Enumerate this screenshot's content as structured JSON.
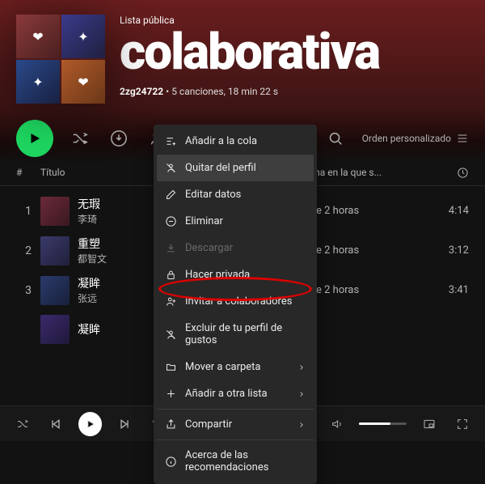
{
  "header": {
    "type_label": "Lista pública",
    "title": "colaborativa",
    "owner": "2zg24722",
    "meta_suffix": "5 canciones, 18 min 22 s"
  },
  "controls": {
    "sort_label": "Orden personalizado"
  },
  "columns": {
    "index": "#",
    "title": "Título",
    "date": "Fecha en la que s...",
    "duration_icon": "clock"
  },
  "tracks": [
    {
      "num": "1",
      "name": "无瑕",
      "artist": "李琦",
      "date": "hace 2 horas",
      "dur": "4:14",
      "c": "c1"
    },
    {
      "num": "2",
      "name": "重塑",
      "artist": "都智文",
      "date": "hace 2 horas",
      "dur": "3:12",
      "c": "c2"
    },
    {
      "num": "3",
      "name": "凝眸",
      "artist": "张远",
      "date": "hace 2 horas",
      "dur": "3:41",
      "c": "c3"
    },
    {
      "num": "",
      "name": "凝眸",
      "artist": "",
      "date": "",
      "dur": "",
      "c": "c4"
    }
  ],
  "context_menu": [
    {
      "icon": "queue",
      "label": "Añadir a la cola"
    },
    {
      "icon": "remove-profile",
      "label": "Quitar del perfil",
      "active": true
    },
    {
      "icon": "edit",
      "label": "Editar datos"
    },
    {
      "icon": "delete",
      "label": "Eliminar"
    },
    {
      "icon": "download",
      "label": "Descargar",
      "disabled": true
    },
    {
      "icon": "lock",
      "label": "Hacer privada"
    },
    {
      "icon": "invite",
      "label": "Invitar a colaboradores",
      "highlighted": true
    },
    {
      "icon": "exclude",
      "label": "Excluir de tu perfil de gustos"
    },
    {
      "icon": "folder",
      "label": "Mover a carpeta",
      "sub": true
    },
    {
      "icon": "add",
      "label": "Añadir a otra lista",
      "sub": true
    },
    {
      "sep": true
    },
    {
      "icon": "share",
      "label": "Compartir",
      "sub": true
    },
    {
      "sep": true
    },
    {
      "icon": "info",
      "label": "Acerca de las recomendaciones"
    }
  ]
}
